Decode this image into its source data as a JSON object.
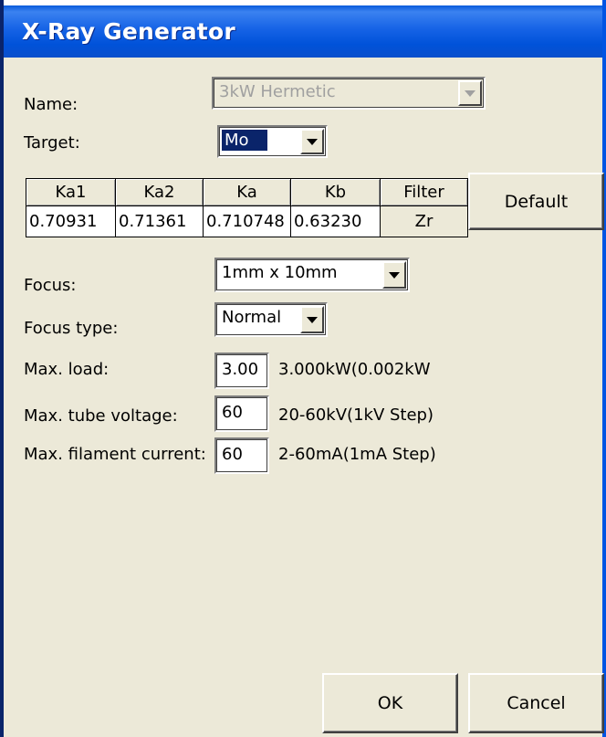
{
  "window": {
    "title": "X-Ray Generator"
  },
  "form": {
    "name_label": "Name:",
    "name_value": "3kW Hermetic",
    "target_label": "Target:",
    "target_value": "Mo",
    "focus_label": "Focus:",
    "focus_value": "1mm x 10mm",
    "focus_type_label": "Focus type:",
    "focus_type_value": "Normal",
    "max_load_label": "Max. load:",
    "max_load_value": "3.00",
    "max_load_range": "3.000kW(0.002kW",
    "max_voltage_label": "Max. tube voltage:",
    "max_voltage_value": "60",
    "max_voltage_range": "20-60kV(1kV Step)",
    "max_current_label": "Max. filament current:",
    "max_current_value": "60",
    "max_current_range": "2-60mA(1mA Step)"
  },
  "wavelengths": {
    "headers": [
      "Ka1",
      "Ka2",
      "Ka",
      "Kb",
      "Filter"
    ],
    "values": [
      "0.70931",
      "0.71361",
      "0.710748",
      "0.63230",
      "Zr"
    ]
  },
  "buttons": {
    "default": "Default",
    "ok": "OK",
    "cancel": "Cancel"
  }
}
